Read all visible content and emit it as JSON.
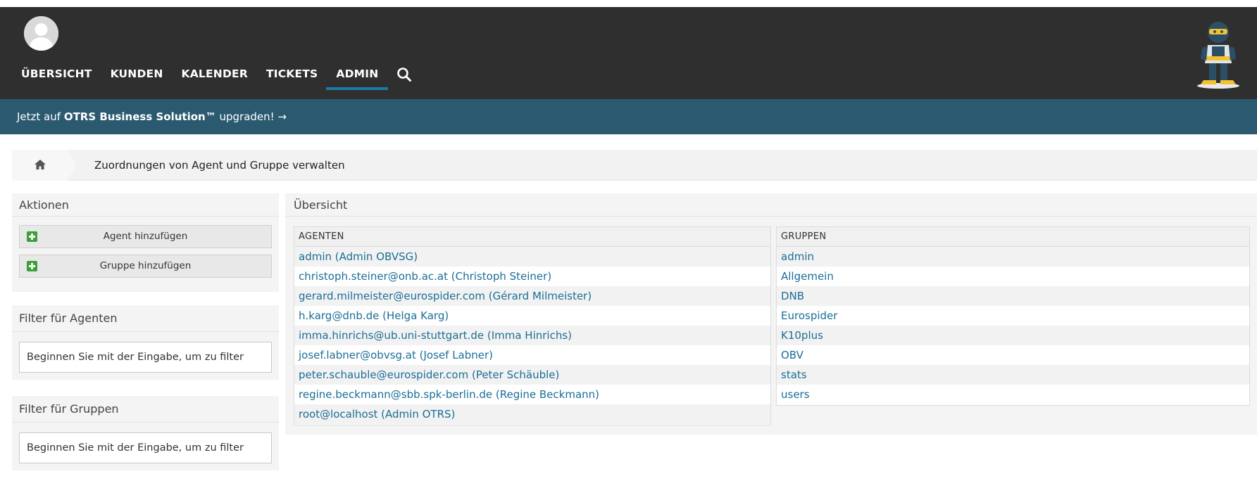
{
  "nav": {
    "items": [
      "ÜBERSICHT",
      "KUNDEN",
      "KALENDER",
      "TICKETS",
      "ADMIN"
    ],
    "active": "ADMIN"
  },
  "banner": {
    "prefix": "Jetzt auf ",
    "product": "OTRS Business Solution™",
    "suffix": " upgraden! →"
  },
  "breadcrumb": {
    "title": "Zuordnungen von Agent und Gruppe verwalten"
  },
  "actions": {
    "heading": "Aktionen",
    "add_agent": "Agent hinzufügen",
    "add_group": "Gruppe hinzufügen"
  },
  "agent_filter": {
    "heading": "Filter für Agenten",
    "placeholder": "Beginnen Sie mit der Eingabe, um zu filter"
  },
  "group_filter": {
    "heading": "Filter für Gruppen",
    "placeholder": "Beginnen Sie mit der Eingabe, um zu filter"
  },
  "overview": {
    "heading": "Übersicht",
    "agents_header": "AGENTEN",
    "agents": [
      "admin (Admin OBVSG)",
      "christoph.steiner@onb.ac.at (Christoph Steiner)",
      "gerard.milmeister@eurospider.com (Gérard Milmeister)",
      "h.karg@dnb.de (Helga Karg)",
      "imma.hinrichs@ub.uni-stuttgart.de (Imma Hinrichs)",
      "josef.labner@obvsg.at (Josef Labner)",
      "peter.schauble@eurospider.com (Peter Schäuble)",
      "regine.beckmann@sbb.spk-berlin.de (Regine Beckmann)",
      "root@localhost (Admin OTRS)"
    ],
    "groups_header": "GRUPPEN",
    "groups": [
      "admin",
      "Allgemein",
      "DNB",
      "Eurospider",
      "K10plus",
      "OBV",
      "stats",
      "users"
    ]
  },
  "colors": {
    "topbar": "#2f2f2f",
    "banner": "#2b5a70",
    "active_underline": "#1b7aa5",
    "link": "#1b6e96",
    "plus": "#3aa136"
  }
}
